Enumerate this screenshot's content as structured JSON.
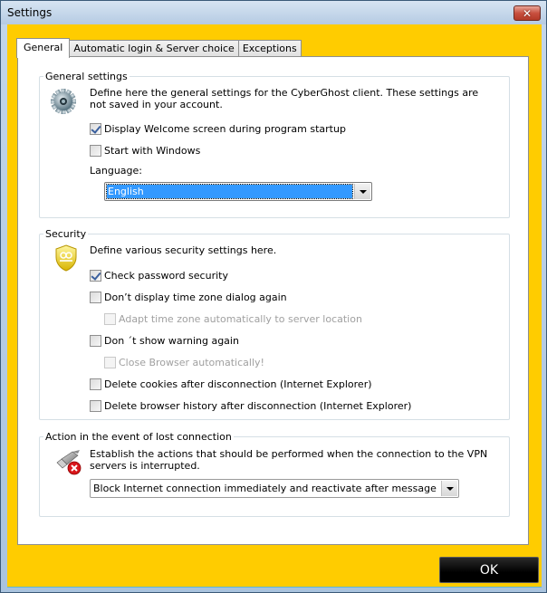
{
  "window": {
    "title": "Settings",
    "close_icon": "close-icon"
  },
  "tabs": [
    {
      "label": "General",
      "active": true
    },
    {
      "label": "Automatic login & Server choice",
      "active": false
    },
    {
      "label": "Exceptions",
      "active": false
    }
  ],
  "general_settings": {
    "legend": "General settings",
    "icon": "gear-icon",
    "description": "Define here the general settings for the CyberGhost client. These settings are not saved in your account.",
    "checkboxes": [
      {
        "label": "Display Welcome screen during program startup",
        "checked": true,
        "enabled": true
      },
      {
        "label": "Start with Windows",
        "checked": false,
        "enabled": true
      }
    ],
    "language_label": "Language:",
    "language_value": "English"
  },
  "security": {
    "legend": "Security",
    "icon": "shield-icon",
    "description": "Define various security settings here.",
    "checkboxes": [
      {
        "label": "Check password security",
        "checked": true,
        "enabled": true
      },
      {
        "label": "Don’t display time zone dialog again",
        "checked": false,
        "enabled": true
      },
      {
        "label": "Adapt time zone automatically to server location",
        "checked": false,
        "enabled": false
      },
      {
        "label": "Don ´t show warning again",
        "checked": false,
        "enabled": true
      },
      {
        "label": "Close Browser automatically!",
        "checked": false,
        "enabled": false
      },
      {
        "label": "Delete cookies after disconnection (Internet Explorer)",
        "checked": false,
        "enabled": true
      },
      {
        "label": "Delete browser history after disconnection (Internet Explorer)",
        "checked": false,
        "enabled": true
      }
    ]
  },
  "lost_connection": {
    "legend": "Action in the event of lost connection",
    "icon": "network-disconnected-icon",
    "description": "Establish the actions that should be performed when the connection to the VPN servers is interrupted.",
    "action_value": "Block Internet connection immediately and reactivate after message"
  },
  "footer": {
    "ok_label": "OK"
  }
}
